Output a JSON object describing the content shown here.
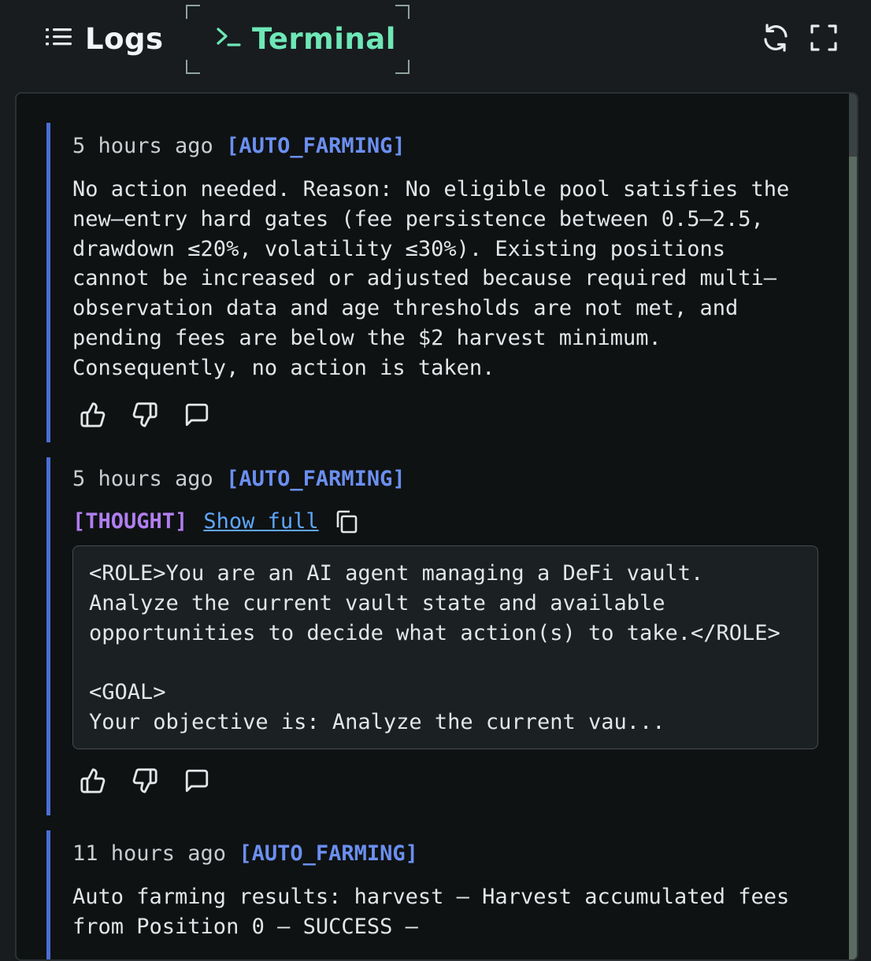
{
  "header": {
    "tabs": [
      {
        "label": "Logs",
        "icon": "list-icon",
        "active": false
      },
      {
        "label": "Terminal",
        "icon": "terminal-icon",
        "active": true
      }
    ],
    "buttons": [
      {
        "icon": "refresh-icon"
      },
      {
        "icon": "fullscreen-icon"
      }
    ],
    "accent_color": "#6ee7b7"
  },
  "entries": [
    {
      "time": "5 hours ago",
      "tag": "[AUTO_FARMING]",
      "message": "No action needed. Reason: No eligible pool satisfies the\nnew–entry hard gates (fee persistence between 0.5–2.5,\ndrawdown ≤20%, volatility ≤30%). Existing positions\ncannot be increased or adjusted because required multi–\nobservation data and age thresholds are not met, and\npending fees are below the $2 harvest minimum.\nConsequently, no action is taken.",
      "actions": [
        "thumbs-up-icon",
        "thumbs-down-icon",
        "comment-icon"
      ]
    },
    {
      "time": "5 hours ago",
      "tag": "[AUTO_FARMING]",
      "thought_tag": "[THOUGHT]",
      "show_full": "Show full",
      "thought": "<ROLE>You are an AI agent managing a DeFi vault.\nAnalyze the current vault state and available\nopportunities to decide what action(s) to take.</ROLE>\n\n<GOAL>\nYour objective is: Analyze the current vau...",
      "actions": [
        "thumbs-up-icon",
        "thumbs-down-icon",
        "comment-icon"
      ]
    },
    {
      "time": "11 hours ago",
      "tag": "[AUTO_FARMING]",
      "message": "Auto farming results: harvest – Harvest accumulated fees\nfrom Position 0 – SUCCESS –"
    }
  ],
  "colors": {
    "entry_border": "#4a6fd6",
    "tag": "#6b8ff0",
    "thought_tag": "#b07ef0",
    "link": "#5fa6ff"
  }
}
